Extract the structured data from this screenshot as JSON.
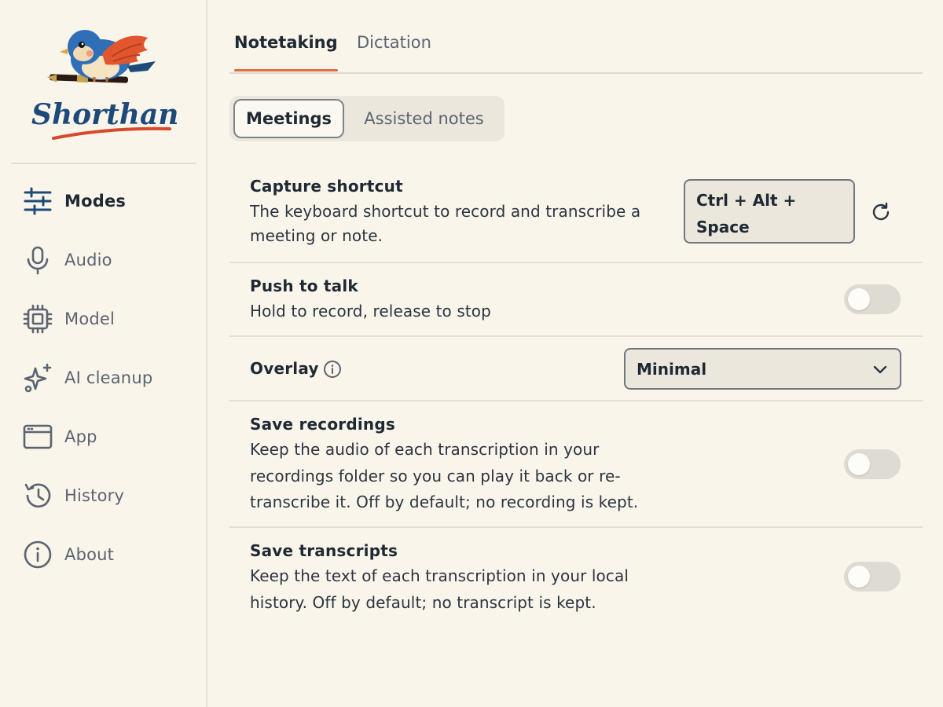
{
  "app": {
    "logo_text": "Shorthand"
  },
  "sidebar": {
    "items": [
      {
        "label": "Modes",
        "icon": "sliders-icon",
        "active": true
      },
      {
        "label": "Audio",
        "icon": "microphone-icon",
        "active": false
      },
      {
        "label": "Model",
        "icon": "chip-icon",
        "active": false
      },
      {
        "label": "AI cleanup",
        "icon": "sparkles-icon",
        "active": false
      },
      {
        "label": "App",
        "icon": "app-window-icon",
        "active": false
      },
      {
        "label": "History",
        "icon": "history-icon",
        "active": false
      },
      {
        "label": "About",
        "icon": "info-circle-icon",
        "active": false
      }
    ]
  },
  "tabs": [
    {
      "label": "Notetaking",
      "active": true
    },
    {
      "label": "Dictation",
      "active": false
    }
  ],
  "segments": [
    {
      "label": "Meetings",
      "active": true
    },
    {
      "label": "Assisted notes",
      "active": false
    }
  ],
  "settings": {
    "capture_shortcut": {
      "title": "Capture shortcut",
      "desc_line1": "The keyboard shortcut to record and transcribe a",
      "desc_line2": "meeting or note.",
      "value_line1": "Ctrl + Alt +",
      "value_line2": "Space"
    },
    "push_to_talk": {
      "title": "Push to talk",
      "desc": "Hold to record, release to stop",
      "enabled": false
    },
    "overlay": {
      "title": "Overlay",
      "selected": "Minimal"
    },
    "save_recordings": {
      "title": "Save recordings",
      "desc_line1": "Keep the audio of each transcription in your",
      "desc_line2": "recordings folder so you can play it back or re-",
      "desc_line3": "transcribe it. Off by default; no recording is kept.",
      "enabled": false
    },
    "save_transcripts": {
      "title": "Save transcripts",
      "desc_line1": "Keep the text of each transcription in your local",
      "desc_line2": "history. Off by default; no transcript is kept.",
      "enabled": false
    }
  },
  "colors": {
    "background": "#f9f5eb",
    "accent": "#e06b45",
    "logo_blue": "#1e4a7a",
    "bird_orange": "#e2562f"
  }
}
